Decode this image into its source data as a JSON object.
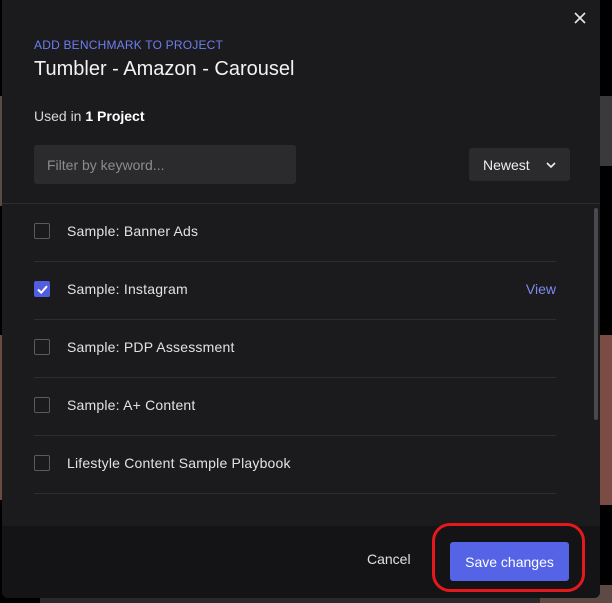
{
  "dialog": {
    "eyebrow": "ADD BENCHMARK TO PROJECT",
    "title": "Tumbler - Amazon - Carousel",
    "used_in_prefix": "Used in",
    "used_in_count": "1 Project",
    "close_icon": "close-icon"
  },
  "filter": {
    "placeholder": "Filter by keyword...",
    "value": ""
  },
  "sort": {
    "selected": "Newest",
    "icon": "chevron-down-icon"
  },
  "projects": [
    {
      "label": "Sample: Banner Ads",
      "checked": false,
      "action": ""
    },
    {
      "label": "Sample: Instagram",
      "checked": true,
      "action": "View"
    },
    {
      "label": "Sample: PDP Assessment",
      "checked": false,
      "action": ""
    },
    {
      "label": "Sample: A+ Content",
      "checked": false,
      "action": ""
    },
    {
      "label": "Lifestyle Content Sample Playbook",
      "checked": false,
      "action": ""
    }
  ],
  "footer": {
    "cancel_label": "Cancel",
    "save_label": "Save changes"
  },
  "colors": {
    "accent": "#5563e6",
    "highlight": "#e5191c",
    "modal_bg": "#1b1b1d"
  }
}
